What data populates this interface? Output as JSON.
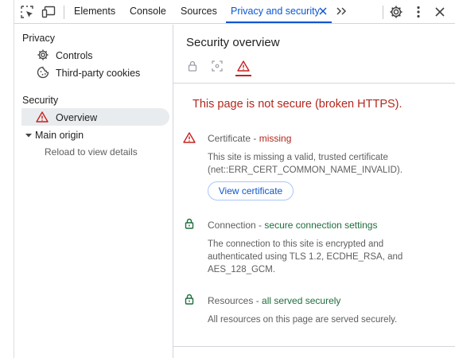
{
  "toolbar": {
    "tabs": [
      {
        "label": "Elements"
      },
      {
        "label": "Console"
      },
      {
        "label": "Sources"
      },
      {
        "label": "Privacy and security"
      }
    ],
    "active_tab_index": 3
  },
  "sidebar": {
    "privacy_heading": "Privacy",
    "controls_label": "Controls",
    "third_party_label": "Third-party cookies",
    "security_heading": "Security",
    "overview_label": "Overview",
    "main_origin_label": "Main origin",
    "reload_hint": "Reload to view details"
  },
  "main": {
    "title": "Security overview",
    "summary": "This page is not secure (broken HTTPS).",
    "sections": {
      "certificate": {
        "name": "Certificate",
        "separator": " - ",
        "status": "missing",
        "description": "This site is missing a valid, trusted certificate (net::ERR_CERT_COMMON_NAME_INVALID).",
        "button": "View certificate"
      },
      "connection": {
        "name": "Connection",
        "separator": " - ",
        "status": "secure connection settings",
        "description": "The connection to this site is encrypted and authenticated using TLS 1.2, ECDHE_RSA, and AES_128_GCM."
      },
      "resources": {
        "name": "Resources",
        "separator": " - ",
        "status": "all served securely",
        "description": "All resources on this page are served securely."
      }
    }
  },
  "colors": {
    "accent": "#0b57d0",
    "danger": "#b3261e",
    "secure": "#1e6e3c",
    "muted": "#5e5e5e"
  },
  "icons": [
    "inspect-icon",
    "device-toolbar-icon",
    "close-icon",
    "more-tabs-icon",
    "settings-icon",
    "kebab-menu-icon",
    "controls-icon",
    "cookie-icon",
    "warning-icon",
    "expand-arrow-icon",
    "lock-icon",
    "info-icon"
  ]
}
